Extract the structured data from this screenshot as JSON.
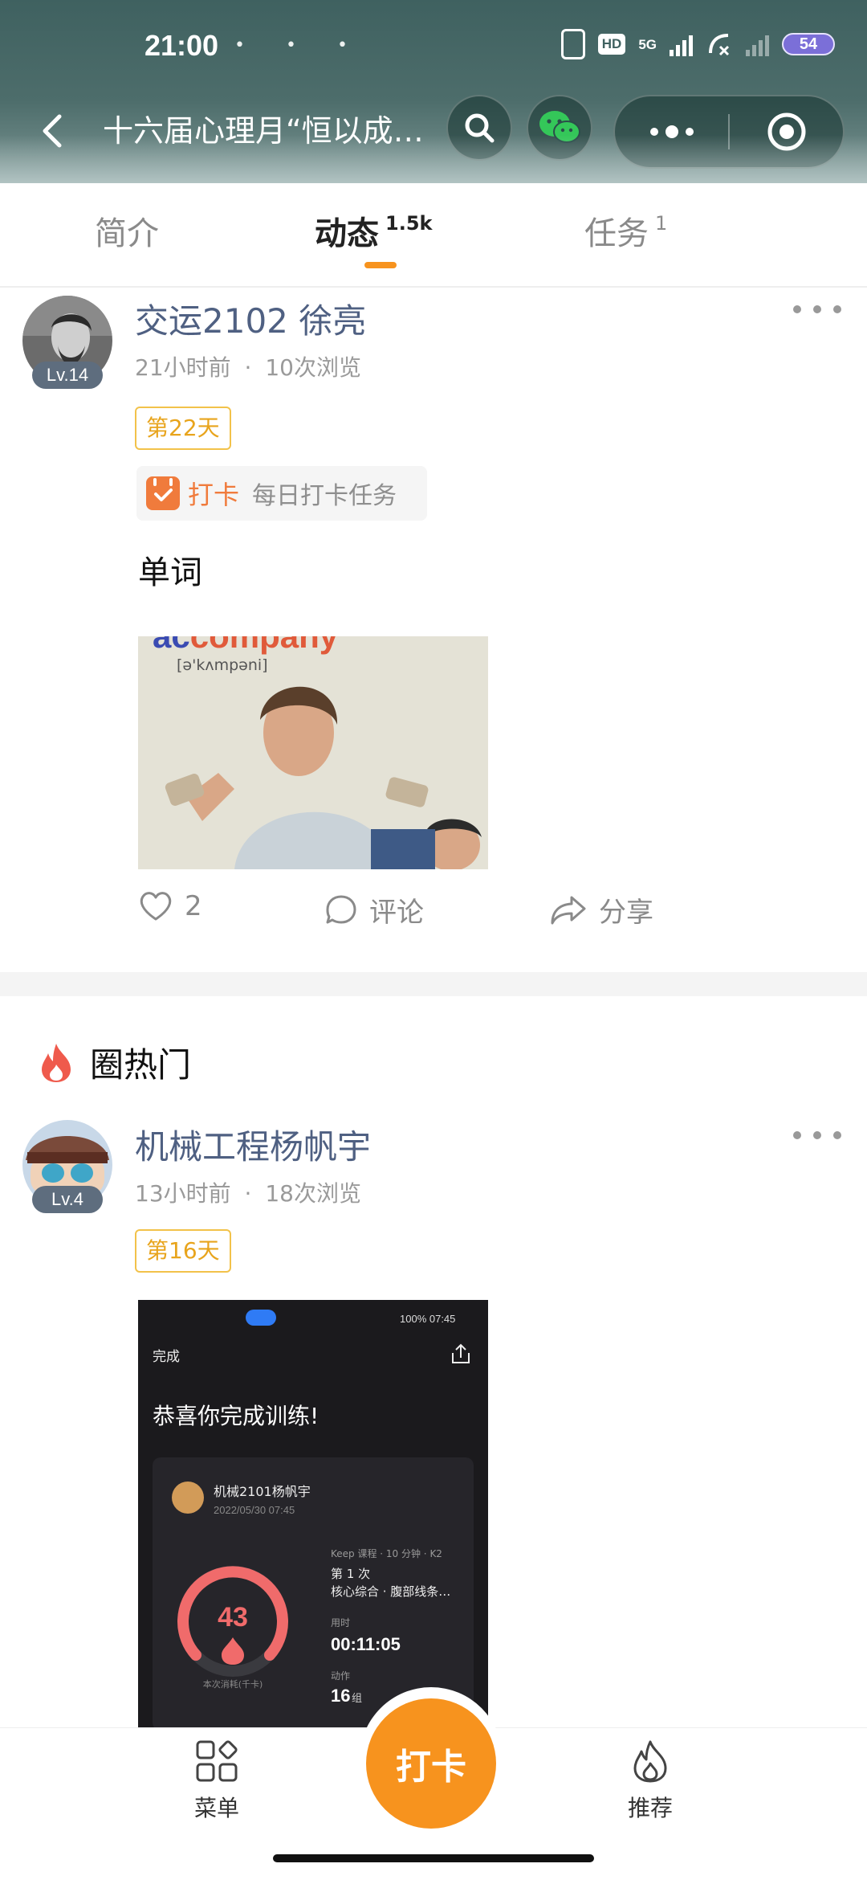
{
  "status_bar": {
    "time": "21:00",
    "left_dots": "• • •",
    "hd": "HD",
    "network": "5G",
    "battery": "54"
  },
  "nav": {
    "title": "十六届心理月“恒以成…"
  },
  "tabs": [
    {
      "label": "简介",
      "sup": ""
    },
    {
      "label": "动态",
      "sup": "1.5k"
    },
    {
      "label": "任务",
      "sup": "1"
    }
  ],
  "posts": [
    {
      "author": "交运2102 徐亮",
      "level": "Lv.14",
      "time_ago": "21小时前",
      "views": "10次浏览",
      "meta_sep": "·",
      "day_tag": "第22天",
      "task_keyword": "打卡",
      "task_desc": "每日打卡任务",
      "text": "单词",
      "image": {
        "word": "accompany",
        "phonetic": "[ə'kʌmpəni]"
      },
      "likes": "2",
      "comment_label": "评论",
      "share_label": "分享"
    },
    {
      "author": "机械工程杨帆宇",
      "level": "Lv.4",
      "time_ago": "13小时前",
      "views": "18次浏览",
      "meta_sep": "·",
      "day_tag": "第16天",
      "image": {
        "status_right": "100% 07:45",
        "done": "完成",
        "congrats": "恭喜你完成训练!",
        "user": "机械2101杨帆宇",
        "date": "2022/05/30 07:45",
        "course": "Keep 课程 · 10 分钟 · K2",
        "times": "第 1 次",
        "course_name": "核心综合 · 腹部线条…",
        "duration_label": "用时",
        "duration": "00:11:05",
        "action_label": "动作",
        "action_count": "16",
        "action_unit": "组",
        "kcal": "43",
        "kcal_label": "本次消耗(千卡)"
      }
    }
  ],
  "hot_section": {
    "title": "圈热门"
  },
  "bottom_bar": {
    "menu_label": "菜单",
    "checkin_label": "打卡",
    "recommend_label": "推荐"
  },
  "colors": {
    "accent": "#f7931e",
    "author": "#4f6082",
    "day_tag": "#e8a41c",
    "header": "#4d6d6b"
  }
}
